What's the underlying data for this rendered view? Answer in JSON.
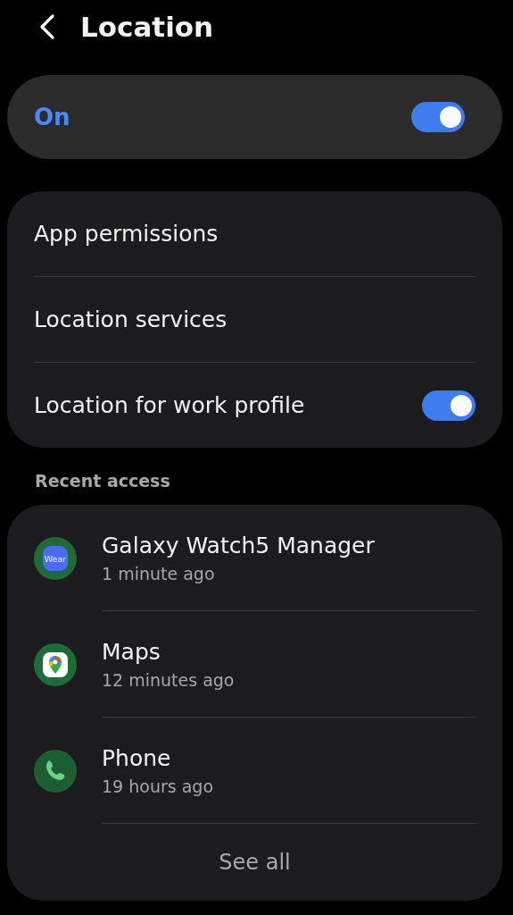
{
  "header": {
    "title": "Location"
  },
  "master": {
    "label": "On",
    "on": true
  },
  "settings": [
    {
      "label": "App permissions",
      "kind": "link"
    },
    {
      "label": "Location services",
      "kind": "link"
    },
    {
      "label": "Location for work profile",
      "kind": "toggle",
      "on": true
    }
  ],
  "recent_access": {
    "heading": "Recent access",
    "apps": [
      {
        "name": "Galaxy Watch5 Manager",
        "time": "1 minute ago",
        "kind": "wear",
        "icon_text": "Wear"
      },
      {
        "name": "Maps",
        "time": "12 minutes ago",
        "kind": "maps"
      },
      {
        "name": "Phone",
        "time": "19 hours ago",
        "kind": "phone"
      }
    ],
    "see_all": "See all"
  }
}
